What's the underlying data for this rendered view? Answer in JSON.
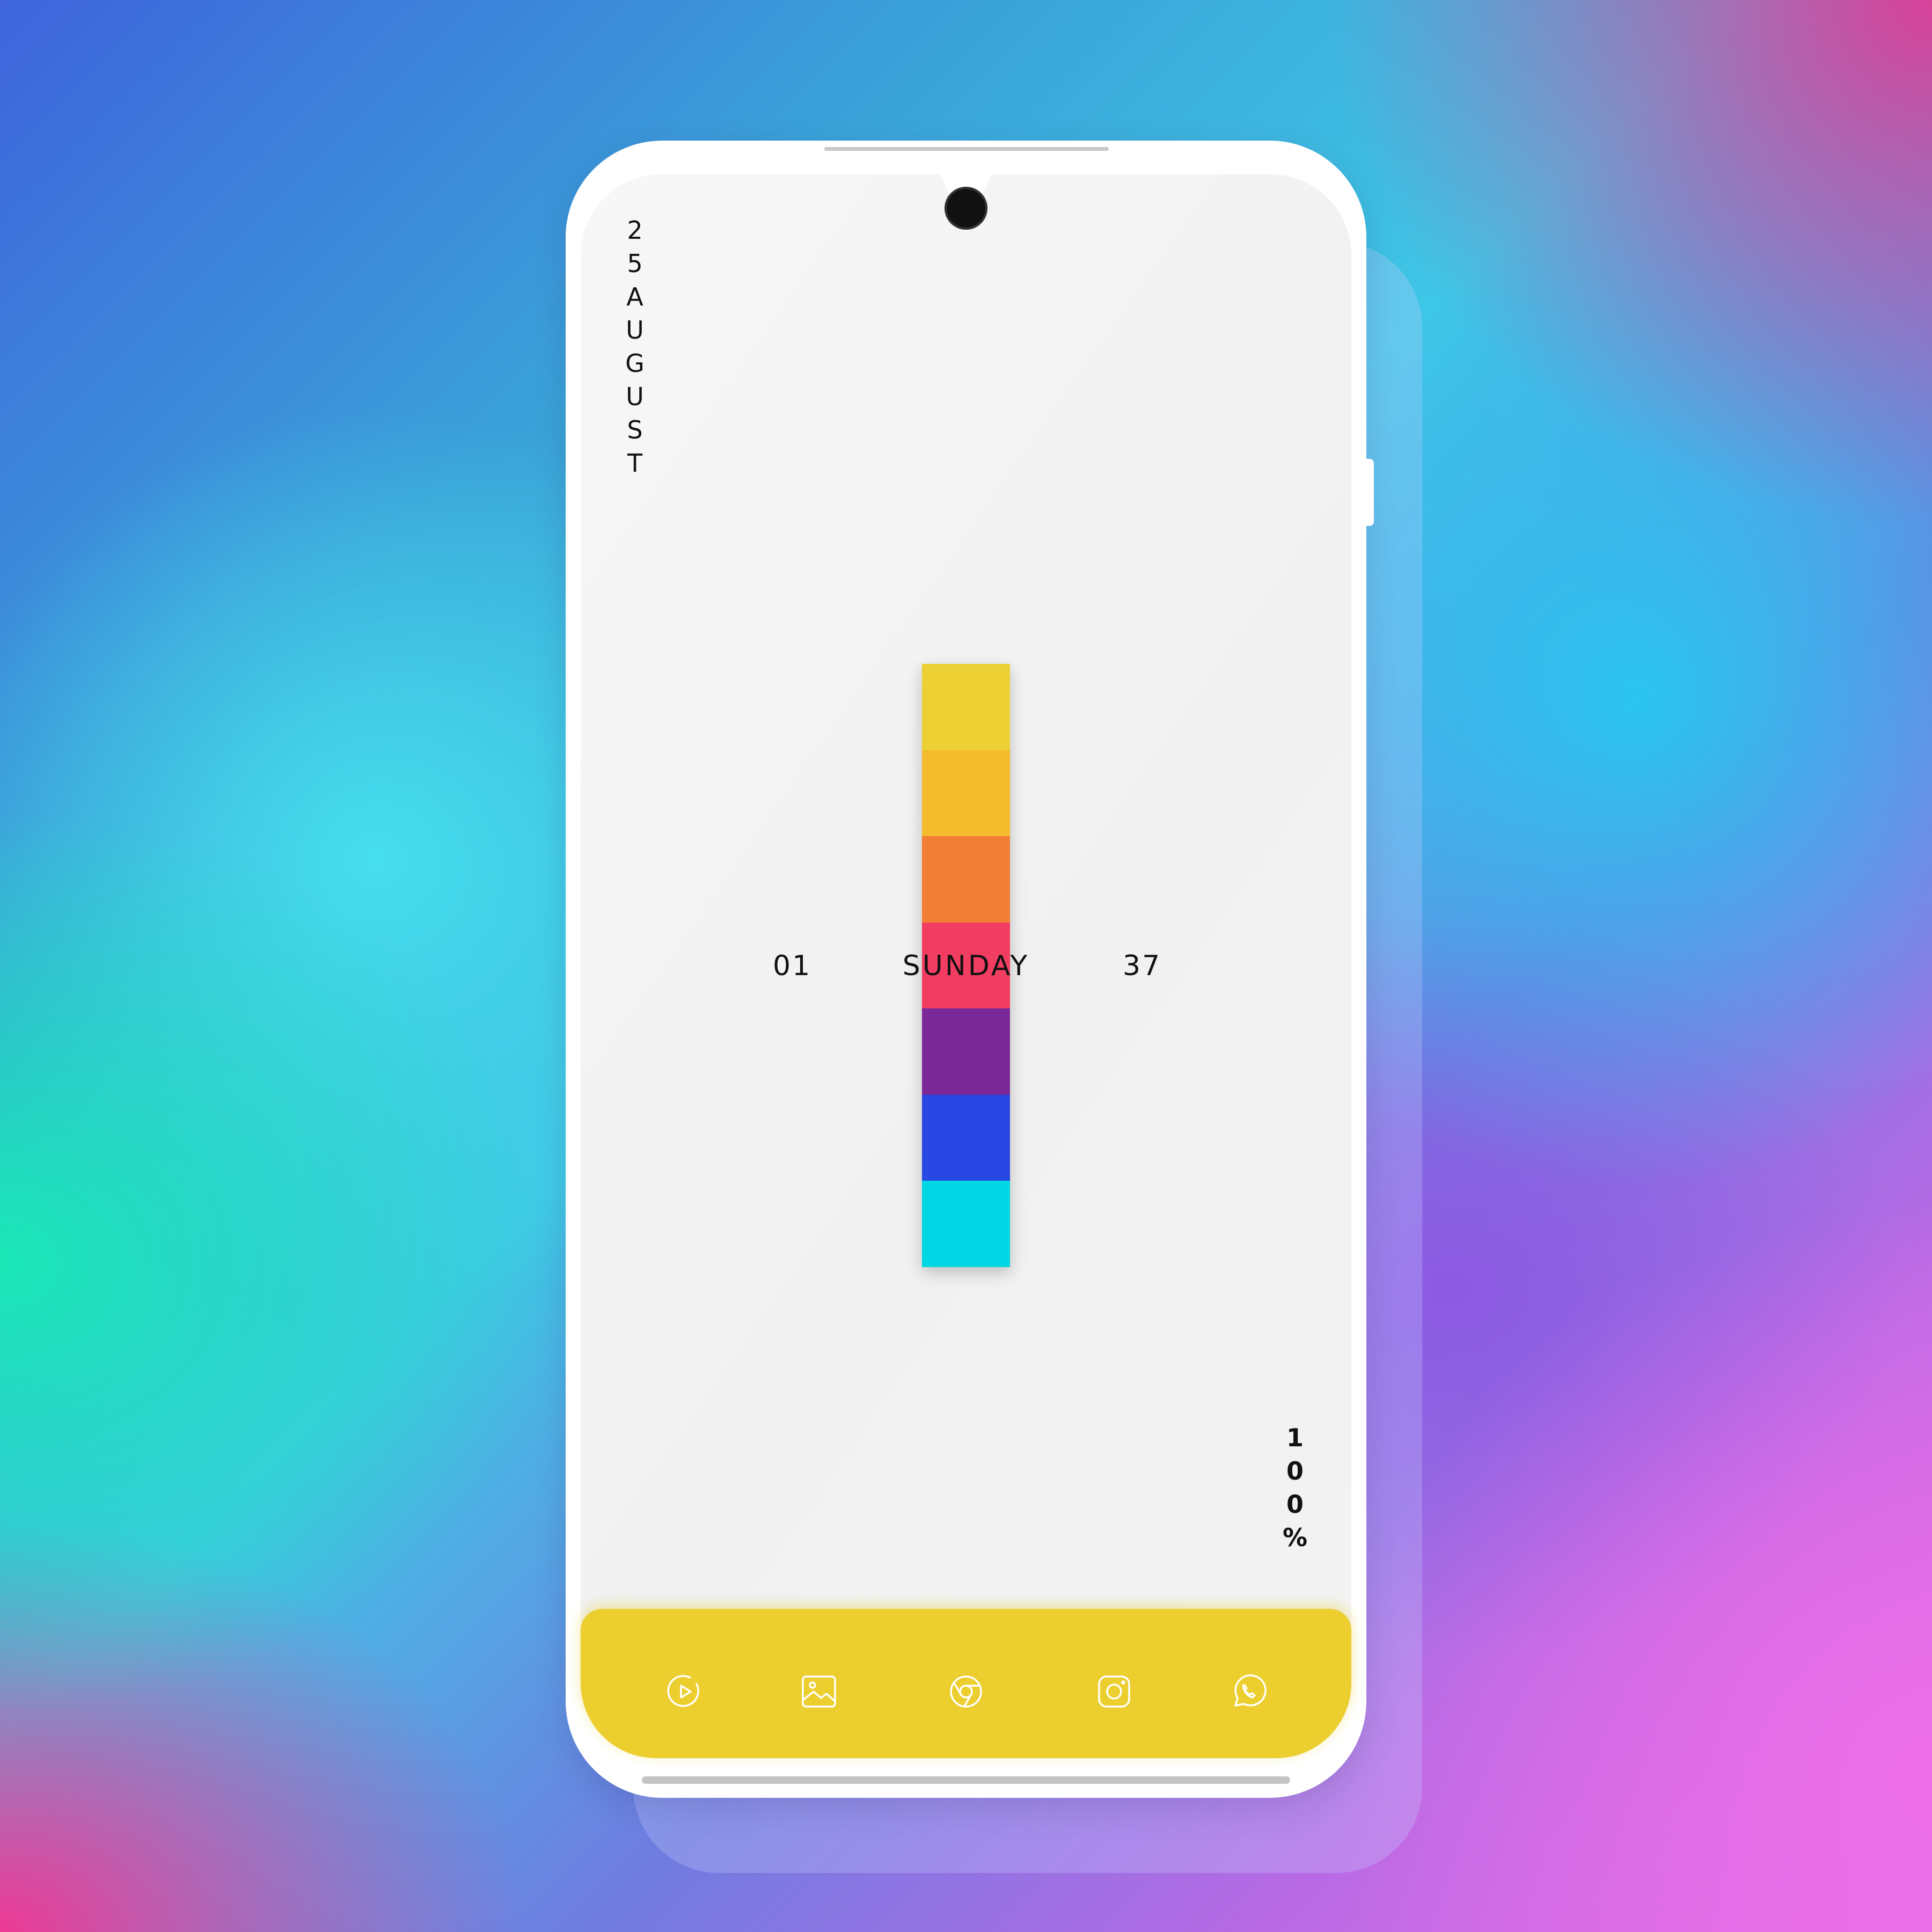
{
  "theme": {
    "dock_color": "#ECCE2E",
    "icon_color": "#FFFFFF",
    "text_color": "#111111",
    "screen_bg": "#F2F2F2"
  },
  "lockscreen": {
    "date_vertical": [
      "2",
      "5",
      "A",
      "U",
      "G",
      "U",
      "S",
      "T"
    ],
    "battery_vertical": [
      "1",
      "0",
      "0",
      "%"
    ],
    "clock": {
      "hour": "01",
      "day": "SUNDAY",
      "minute": "37"
    },
    "color_bar": [
      "#ECD034",
      "#F4BB2D",
      "#F07E37",
      "#F23D62",
      "#7B2898",
      "#2947E2",
      "#00D6E4"
    ]
  },
  "dock": {
    "apps": [
      {
        "name": "play-store",
        "icon": "play-circle-icon"
      },
      {
        "name": "gallery",
        "icon": "image-icon"
      },
      {
        "name": "chrome",
        "icon": "chrome-icon"
      },
      {
        "name": "instagram",
        "icon": "instagram-icon"
      },
      {
        "name": "whatsapp",
        "icon": "whatsapp-icon"
      }
    ]
  }
}
